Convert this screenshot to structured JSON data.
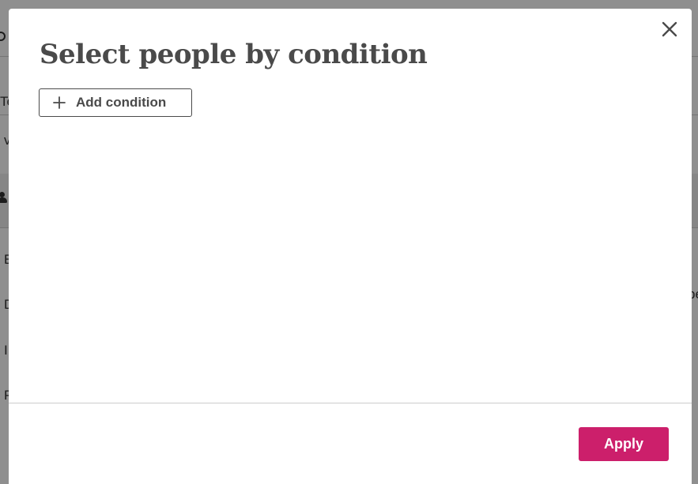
{
  "background": {
    "fragments": [
      {
        "name": "bg-text-te",
        "text": "Te"
      },
      {
        "name": "bg-text-v",
        "text": "v"
      },
      {
        "name": "bg-text-e",
        "text": "E"
      },
      {
        "name": "bg-text-d",
        "text": "D"
      },
      {
        "name": "bg-text-i",
        "text": "I"
      },
      {
        "name": "bg-text-p",
        "text": "P"
      },
      {
        "name": "bg-text-right",
        "text": "pe"
      }
    ]
  },
  "modal": {
    "title": "Select people by condition",
    "add_condition_label": "Add condition",
    "apply_label": "Apply",
    "icons": {
      "close": "close-icon",
      "add": "plus-icon"
    },
    "colors": {
      "accent": "#cc1f6b",
      "title": "#4a4a4a"
    }
  }
}
